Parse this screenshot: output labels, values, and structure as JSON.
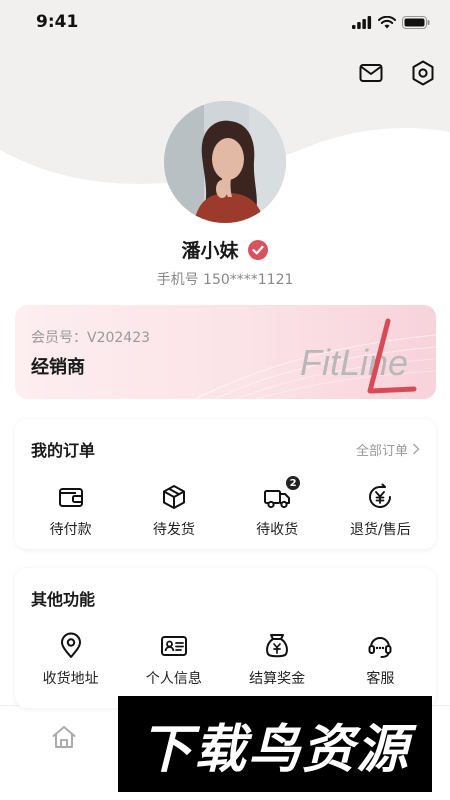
{
  "status_bar": {
    "time": "9:41"
  },
  "profile": {
    "name": "潘小妹",
    "phone": "手机号 150****1121"
  },
  "member_card": {
    "member_no": "会员号：V202423",
    "member_type": "经销商",
    "logo_text": "FitLine"
  },
  "orders": {
    "title": "我的订单",
    "view_all": "全部订单",
    "items": [
      {
        "label": "待付款",
        "icon": "wallet-icon"
      },
      {
        "label": "待发货",
        "icon": "package-icon"
      },
      {
        "label": "待收货",
        "icon": "truck-icon",
        "badge": "2"
      },
      {
        "label": "退货/售后",
        "icon": "yen-refund-icon"
      }
    ]
  },
  "other_functions": {
    "title": "其他功能",
    "items": [
      {
        "label": "收货地址",
        "icon": "location-pin-icon"
      },
      {
        "label": "个人信息",
        "icon": "id-card-icon"
      },
      {
        "label": "结算奖金",
        "icon": "money-bag-icon"
      },
      {
        "label": "客服",
        "icon": "headset-icon"
      }
    ]
  },
  "tabbar": {
    "home_icon": "home-icon"
  },
  "watermark": {
    "text": "下载鸟资源"
  },
  "colors": {
    "accent": "#d9535f",
    "card_pink": "#fbe3e7",
    "header_bg": "#f1f0ee"
  }
}
